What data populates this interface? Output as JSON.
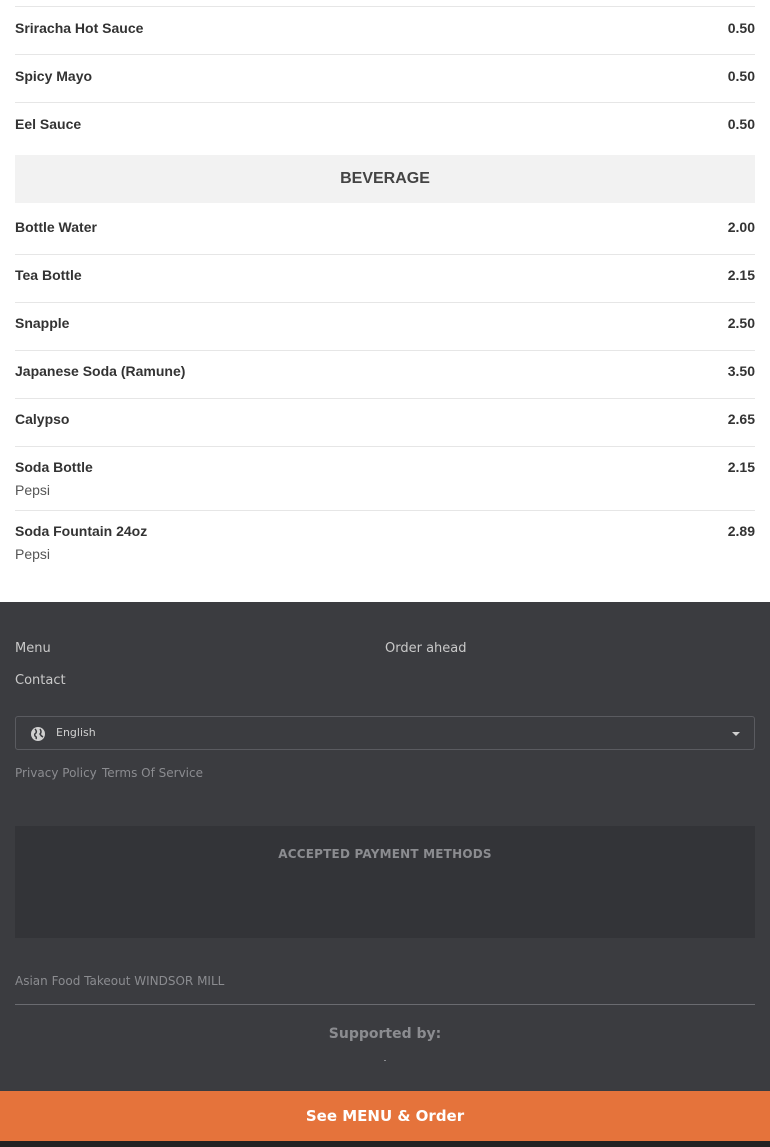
{
  "sauces": [
    {
      "name": "Sriracha Hot Sauce",
      "price": "0.50"
    },
    {
      "name": "Spicy Mayo",
      "price": "0.50"
    },
    {
      "name": "Eel Sauce",
      "price": "0.50"
    }
  ],
  "beverage": {
    "heading": "BEVERAGE",
    "items": [
      {
        "name": "Bottle Water",
        "price": "2.00"
      },
      {
        "name": "Tea Bottle",
        "price": "2.15"
      },
      {
        "name": "Snapple",
        "price": "2.50"
      },
      {
        "name": "Japanese Soda (Ramune)",
        "price": "3.50"
      },
      {
        "name": "Calypso",
        "price": "2.65"
      },
      {
        "name": "Soda Bottle",
        "price": "2.15",
        "desc": "Pepsi"
      },
      {
        "name": "Soda Fountain 24oz",
        "price": "2.89",
        "desc": "Pepsi"
      }
    ]
  },
  "footer": {
    "nav": {
      "menu": "Menu",
      "order_ahead": "Order ahead",
      "contact": "Contact"
    },
    "language": {
      "selected": "English",
      "icon": "globe-icon"
    },
    "legal": {
      "privacy": "Privacy Policy",
      "separator": "·",
      "terms": "Terms Of Service"
    },
    "payments_title": "ACCEPTED PAYMENT METHODS",
    "business_line": "Asian Food Takeout WINDSOR MILL",
    "supported_by": "Supported by:"
  },
  "cta": {
    "label": "See MENU & Order",
    "color": "#e5733b"
  }
}
